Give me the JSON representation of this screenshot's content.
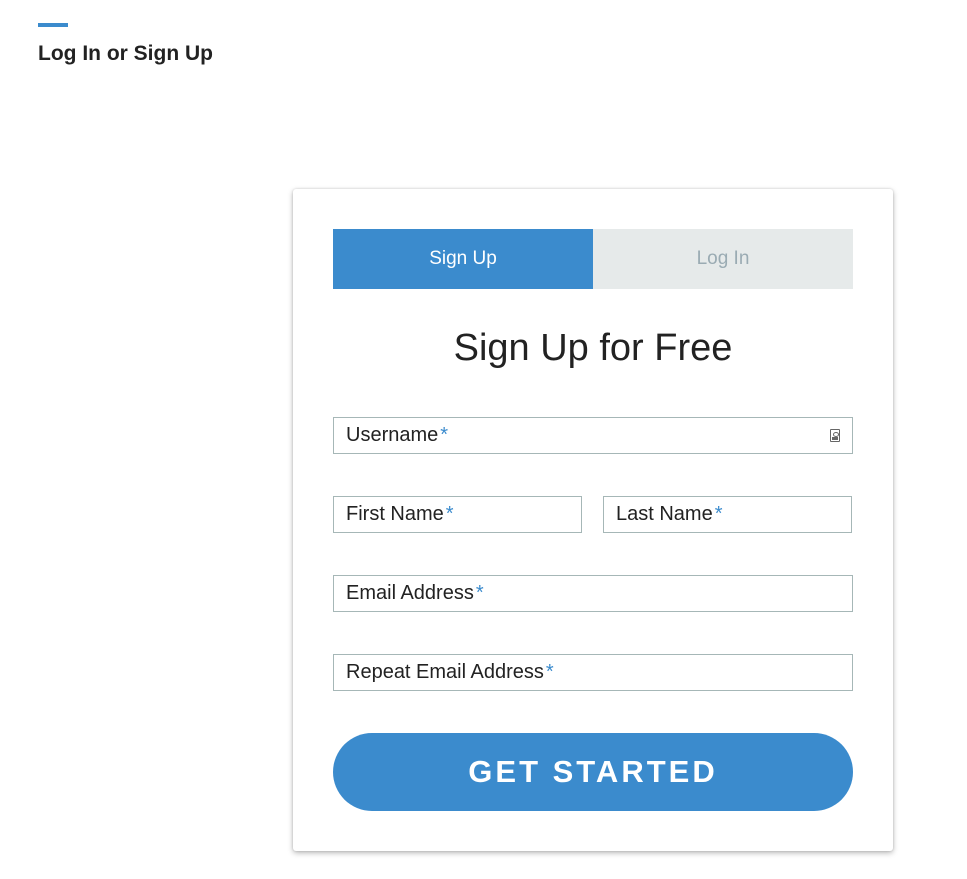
{
  "header": {
    "accent_color": "#3b8bcd",
    "title": "Log In or Sign Up"
  },
  "auth_card": {
    "tabs": [
      {
        "label": "Sign Up",
        "active": true
      },
      {
        "label": "Log In",
        "active": false
      }
    ],
    "heading": "Sign Up for Free",
    "fields": {
      "username": {
        "placeholder": "Username",
        "required_mark": "*",
        "icon": "contact-card-icon"
      },
      "first_name": {
        "placeholder": "First Name",
        "required_mark": "*"
      },
      "last_name": {
        "placeholder": "Last Name",
        "required_mark": "*"
      },
      "email": {
        "placeholder": "Email Address",
        "required_mark": "*"
      },
      "repeat_email": {
        "placeholder": "Repeat Email Address",
        "required_mark": "*"
      }
    },
    "submit_label": "GET STARTED"
  },
  "colors": {
    "primary": "#3b8bcd",
    "tab_inactive_bg": "#e6eaea",
    "tab_inactive_text": "#9aabb3",
    "field_border": "#a6b7b7"
  }
}
